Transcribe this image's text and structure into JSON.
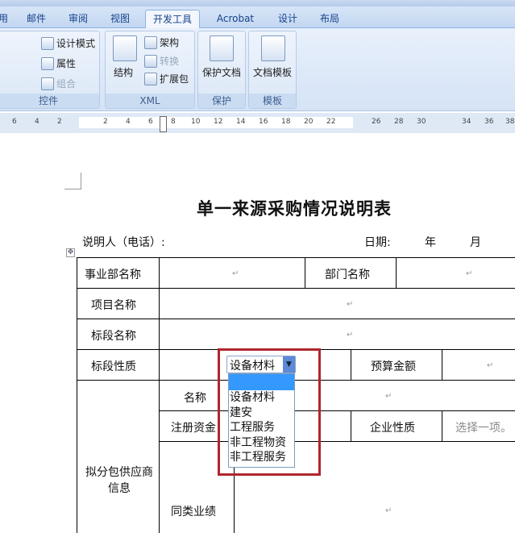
{
  "ribbon": {
    "tabs": [
      "用",
      "邮件",
      "审阅",
      "视图",
      "开发工具",
      "Acrobat",
      "设计",
      "布局"
    ],
    "active_tab": "开发工具",
    "controls": {
      "design_mode": "设计模式",
      "properties": "属性",
      "group": "组合",
      "label": "控件"
    },
    "xml": {
      "structure": "结构",
      "schema": "架构",
      "transform": "转换",
      "expansion": "扩展包",
      "label": "XML"
    },
    "protect": {
      "protect_doc": "保护文档",
      "label": "保护"
    },
    "templates": {
      "doc_template": "文档模板",
      "label": "模板"
    }
  },
  "ruler": {
    "numbers": [
      "6",
      "4",
      "2",
      "2",
      "4",
      "6",
      "8",
      "10",
      "12",
      "14",
      "16",
      "18",
      "20",
      "22",
      "26",
      "28",
      "30",
      "34",
      "36",
      "38"
    ]
  },
  "document": {
    "title": "单一来源采购情况说明表",
    "explainer": "说明人（电话）:",
    "date_label": "日期:",
    "year": "年",
    "month": "月",
    "rows": {
      "division": "事业部名称",
      "department": "部门名称",
      "project": "项目名称",
      "section_name": "标段名称",
      "section_type": "标段性质",
      "budget": "预算金额",
      "supplier_info": "拟分包供应商信息",
      "name": "名称",
      "reg_capital": "注册资金",
      "enterprise_type": "企业性质",
      "enterprise_placeholder": "选择一项。",
      "similar_perf": "同类业绩"
    },
    "para_mark": "↵"
  },
  "dropdown": {
    "selected": "设备材料",
    "options": [
      "",
      "设备材料",
      "建安",
      "工程服务",
      "非工程物资",
      "非工程服务"
    ]
  },
  "colors": {
    "highlight_box": "#b0262e",
    "selection": "#3399ff"
  }
}
